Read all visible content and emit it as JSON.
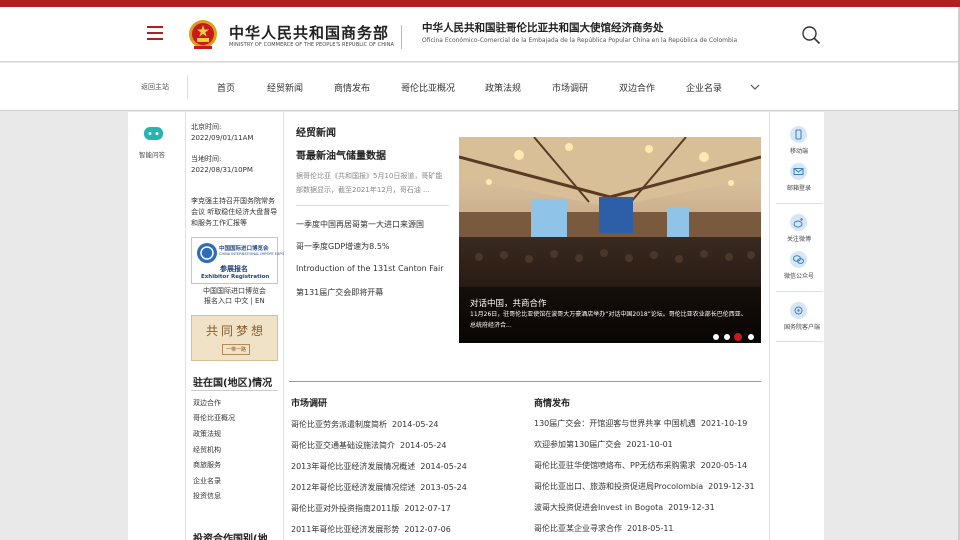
{
  "header": {
    "ministry_cn": "中华人民共和国商务部",
    "ministry_en": "MINISTRY OF COMMERCE OF THE PEOPLE'S REPUBLIC OF CHINA",
    "office_cn": "中华人民共和国驻哥伦比亚共和国大使馆经济商务处",
    "office_es": "Oficina Económico-Comercial de la Embajada de la República Popular China en la República de Colombia"
  },
  "nav": {
    "back": "返回主站",
    "items": [
      "首页",
      "经贸新闻",
      "商情发布",
      "哥伦比亚概况",
      "政策法规",
      "市场调研",
      "双边合作",
      "企业名录"
    ]
  },
  "left": {
    "smart_label": "智能问答"
  },
  "sidebar": {
    "beijing_label": "北京时间:",
    "beijing_time": "2022/09/01/11AM",
    "local_label": "当地时间:",
    "local_time": "2022/08/31/10PM",
    "notice_1": "李克强主持召开国务院常务",
    "notice_2": "会议 听取稳住经济大盘督导",
    "notice_3": "和服务工作汇报等",
    "expo_name_cn": "中国国际进口博览会",
    "expo_name_en": "CHINA INTERNATIONAL IMPORT EXPO",
    "expo_reg_cn": "参展报名",
    "expo_reg_en": "Exhibitor Registration",
    "expo_cap_1": "中国国际进口博览会",
    "expo_cap_2": "报名入口 中文 | EN",
    "dream_text": "共同梦想",
    "dream_sub": "一带一路",
    "region_title": "驻在国(地区)情况",
    "region_links": [
      "双边合作",
      "哥伦比亚概况",
      "政策法规",
      "经贸机构",
      "商旅服务",
      "企业名录",
      "投资信息"
    ],
    "bottom_title": "投资合作国别(地"
  },
  "trade": {
    "title": "经贸新闻",
    "headline": "哥最新油气储量数据",
    "summary": "据哥伦比亚《共和国报》5月10日报道，哥矿能部数据显示，截至2021年12月，哥石油 ...",
    "links": [
      "一季度中国再居哥第一大进口来源国",
      "哥一季度GDP增速为8.5%",
      "Introduction of the 131st Canton Fair",
      "第131届广交会即将开幕"
    ]
  },
  "slide": {
    "title": "对话中国，共商合作",
    "text": "11月26日，驻哥伦比亚使馆在波哥大万豪酒店举办“对话中国2018”论坛。哥伦比亚农业部长巴伦西亚、总统府经济合..."
  },
  "market": {
    "title": "市场调研",
    "items": [
      {
        "text": "哥伦比亚劳务派遣制度简析",
        "date": "2014-05-24"
      },
      {
        "text": "哥伦比亚交通基础设施法简介",
        "date": "2014-05-24"
      },
      {
        "text": "2013年哥伦比亚经济发展情况概述",
        "date": "2014-05-24"
      },
      {
        "text": "2012年哥伦比亚经济发展情况综述",
        "date": "2013-05-24"
      },
      {
        "text": "哥伦比亚对外投资指南2011版",
        "date": "2012-07-17"
      },
      {
        "text": "2011年哥伦比亚经济发展形势",
        "date": "2012-07-06"
      }
    ]
  },
  "business": {
    "title": "商情发布",
    "items": [
      {
        "text": "130届广交会：开馆迎客与世界共享 中国机遇",
        "date": "2021-10-19"
      },
      {
        "text": "欢迎参加第130届广交会",
        "date": "2021-10-01"
      },
      {
        "text": "哥伦比亚驻华使馆喷烙布、PP无纺布采购需求",
        "date": "2020-05-14"
      },
      {
        "text": "哥伦比亚出口、旅游和投资促进局Procolombia",
        "date": "2019-12-31"
      },
      {
        "text": "波哥大投资促进会Invest in Bogota",
        "date": "2019-12-31"
      },
      {
        "text": "哥伦比亚某企业寻求合作",
        "date": "2018-05-11"
      }
    ]
  },
  "right": {
    "items": [
      "移动端",
      "邮箱登录",
      "关注微博",
      "微信公众号",
      "国务院客户端"
    ]
  },
  "colors": {
    "brand_red": "#b0201f",
    "accent_red": "#c8191d"
  }
}
